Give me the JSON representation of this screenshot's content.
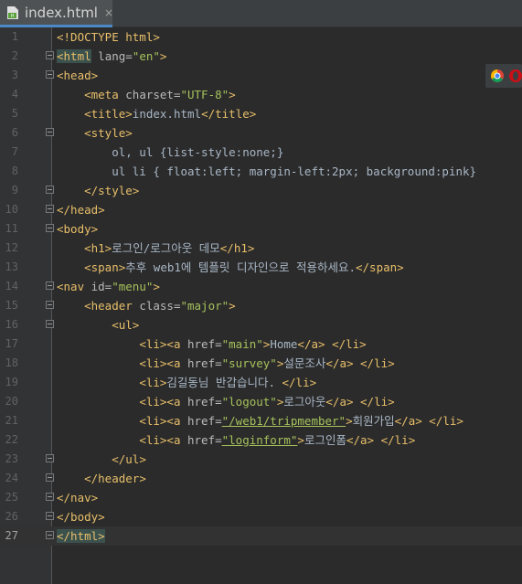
{
  "tab": {
    "filename": "index.html",
    "close_symbol": "×",
    "icon": "html-file-icon"
  },
  "browser_icons": [
    "chrome-icon",
    "opera-icon"
  ],
  "colors": {
    "background": "#2b2b2b",
    "tag": "#e8bf6a",
    "attribute": "#bababa",
    "string": "#a5c25c",
    "text": "#a9b7c6",
    "line_number": "#606366"
  },
  "lines": [
    {
      "n": "1",
      "segs": [
        [
          "tag",
          "<!DOCTYPE html>"
        ]
      ]
    },
    {
      "n": "2",
      "segs": [
        [
          "tag",
          "<html"
        ],
        [
          "attr",
          " lang="
        ],
        [
          "val",
          "\"en\""
        ],
        [
          "tag",
          ">"
        ]
      ]
    },
    {
      "n": "3",
      "segs": [
        [
          "tag",
          "<head>"
        ]
      ]
    },
    {
      "n": "4",
      "segs": [
        [
          "txt",
          "    "
        ],
        [
          "tag",
          "<meta"
        ],
        [
          "attr",
          " charset="
        ],
        [
          "val",
          "\"UTF-8\""
        ],
        [
          "tag",
          ">"
        ]
      ]
    },
    {
      "n": "5",
      "segs": [
        [
          "txt",
          "    "
        ],
        [
          "tag",
          "<title>"
        ],
        [
          "txt",
          "index.html"
        ],
        [
          "tag",
          "</title>"
        ]
      ]
    },
    {
      "n": "6",
      "segs": [
        [
          "txt",
          "    "
        ],
        [
          "tag",
          "<style>"
        ]
      ]
    },
    {
      "n": "7",
      "segs": [
        [
          "txt",
          "        ol, ul {list-style:none;}"
        ]
      ]
    },
    {
      "n": "8",
      "segs": [
        [
          "txt",
          "        ul li { float:left; margin-left:2px; background:pink}"
        ]
      ]
    },
    {
      "n": "9",
      "segs": [
        [
          "txt",
          "    "
        ],
        [
          "tag",
          "</style>"
        ]
      ]
    },
    {
      "n": "10",
      "segs": [
        [
          "tag",
          "</head>"
        ]
      ]
    },
    {
      "n": "11",
      "segs": [
        [
          "tag",
          "<body>"
        ]
      ]
    },
    {
      "n": "12",
      "segs": [
        [
          "txt",
          "    "
        ],
        [
          "tag",
          "<h1>"
        ],
        [
          "txt",
          "로그인/로그아웃 데모"
        ],
        [
          "tag",
          "</h1>"
        ]
      ]
    },
    {
      "n": "13",
      "segs": [
        [
          "txt",
          "    "
        ],
        [
          "tag",
          "<span>"
        ],
        [
          "txt",
          "추후 web1에 템플릿 디자인으로 적용하세요."
        ],
        [
          "tag",
          "</span>"
        ]
      ]
    },
    {
      "n": "14",
      "segs": [
        [
          "tag",
          "<nav"
        ],
        [
          "attr",
          " id="
        ],
        [
          "val",
          "\"menu\""
        ],
        [
          "tag",
          ">"
        ]
      ]
    },
    {
      "n": "15",
      "segs": [
        [
          "txt",
          "    "
        ],
        [
          "tag",
          "<header"
        ],
        [
          "attr",
          " class="
        ],
        [
          "val",
          "\"major\""
        ],
        [
          "tag",
          ">"
        ]
      ]
    },
    {
      "n": "16",
      "segs": [
        [
          "txt",
          "        "
        ],
        [
          "tag",
          "<ul>"
        ]
      ]
    },
    {
      "n": "17",
      "segs": [
        [
          "txt",
          "            "
        ],
        [
          "tag",
          "<li><a"
        ],
        [
          "attr",
          " href="
        ],
        [
          "val",
          "\"main\""
        ],
        [
          "tag",
          ">"
        ],
        [
          "txt",
          "Home"
        ],
        [
          "tag",
          "</a>"
        ],
        [
          "txt",
          " "
        ],
        [
          "tag",
          "</li>"
        ]
      ]
    },
    {
      "n": "18",
      "segs": [
        [
          "txt",
          "            "
        ],
        [
          "tag",
          "<li><a"
        ],
        [
          "attr",
          " href="
        ],
        [
          "val",
          "\"survey\""
        ],
        [
          "tag",
          ">"
        ],
        [
          "txt",
          "설문조사"
        ],
        [
          "tag",
          "</a>"
        ],
        [
          "txt",
          " "
        ],
        [
          "tag",
          "</li>"
        ]
      ]
    },
    {
      "n": "19",
      "segs": [
        [
          "txt",
          "            "
        ],
        [
          "tag",
          "<li>"
        ],
        [
          "txt",
          "김길동님 반갑습니다. "
        ],
        [
          "tag",
          "</li>"
        ]
      ]
    },
    {
      "n": "20",
      "segs": [
        [
          "txt",
          "            "
        ],
        [
          "tag",
          "<li><a"
        ],
        [
          "attr",
          " href="
        ],
        [
          "val",
          "\"logout\""
        ],
        [
          "tag",
          ">"
        ],
        [
          "txt",
          "로그아웃"
        ],
        [
          "tag",
          "</a>"
        ],
        [
          "txt",
          " "
        ],
        [
          "tag",
          "</li>"
        ]
      ]
    },
    {
      "n": "21",
      "segs": [
        [
          "txt",
          "            "
        ],
        [
          "tag",
          "<li><a"
        ],
        [
          "attr",
          " href="
        ],
        [
          "val",
          "\"/web1/tripmember\""
        ],
        [
          "tag",
          ">"
        ],
        [
          "txt",
          "회원가입"
        ],
        [
          "tag",
          "</a>"
        ],
        [
          "txt",
          " "
        ],
        [
          "tag",
          "</li>"
        ]
      ]
    },
    {
      "n": "22",
      "segs": [
        [
          "txt",
          "            "
        ],
        [
          "tag",
          "<li><a"
        ],
        [
          "attr",
          " href="
        ],
        [
          "val",
          "\"loginform\""
        ],
        [
          "tag",
          ">"
        ],
        [
          "txt",
          "로그인폼"
        ],
        [
          "tag",
          "</a>"
        ],
        [
          "txt",
          " "
        ],
        [
          "tag",
          "</li>"
        ]
      ]
    },
    {
      "n": "23",
      "segs": [
        [
          "txt",
          "        "
        ],
        [
          "tag",
          "</ul>"
        ]
      ]
    },
    {
      "n": "24",
      "segs": [
        [
          "txt",
          "    "
        ],
        [
          "tag",
          "</header>"
        ]
      ]
    },
    {
      "n": "25",
      "segs": [
        [
          "tag",
          "</nav>"
        ]
      ]
    },
    {
      "n": "26",
      "segs": [
        [
          "tag",
          "</body>"
        ]
      ]
    },
    {
      "n": "27",
      "segs": [
        [
          "tag",
          "</html>"
        ]
      ]
    }
  ]
}
